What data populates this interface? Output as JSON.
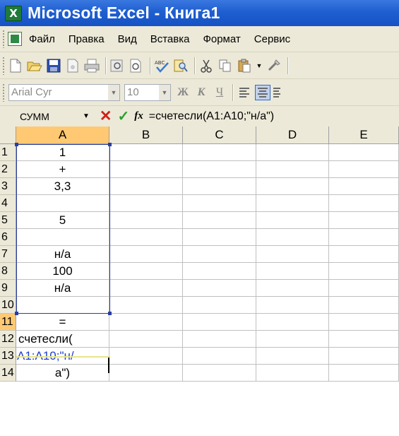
{
  "window": {
    "title": "Microsoft Excel - Книга1",
    "app_icon": "X"
  },
  "menu": {
    "items": [
      {
        "label": "Файл"
      },
      {
        "label": "Правка"
      },
      {
        "label": "Вид"
      },
      {
        "label": "Вставка"
      },
      {
        "label": "Формат"
      },
      {
        "label": "Сервис"
      }
    ]
  },
  "toolbar": {
    "icons": [
      "new-icon",
      "open-icon",
      "save-icon",
      "permission-icon",
      "print-icon",
      "print-preview-icon",
      "spelling-icon",
      "research-icon",
      "cut-icon",
      "copy-icon",
      "paste-icon",
      "format-painter-icon"
    ]
  },
  "format_toolbar": {
    "font_name": "Arial Cyr",
    "font_size": "10",
    "bold_label": "Ж",
    "italic_label": "К",
    "underline_label": "Ч"
  },
  "formula_bar": {
    "name_box": "СУММ",
    "formula": "=счетесли(A1:A10;\"н/а\")"
  },
  "columns": [
    "A",
    "B",
    "C",
    "D",
    "E"
  ],
  "rows": [
    {
      "num": "1",
      "a": "1"
    },
    {
      "num": "2",
      "a": "+"
    },
    {
      "num": "3",
      "a": "3,3"
    },
    {
      "num": "4",
      "a": ""
    },
    {
      "num": "5",
      "a": "5"
    },
    {
      "num": "6",
      "a": ""
    },
    {
      "num": "7",
      "a": "н/а"
    },
    {
      "num": "8",
      "a": "100"
    },
    {
      "num": "9",
      "a": "н/а"
    },
    {
      "num": "10",
      "a": ""
    },
    {
      "num": "11",
      "a": "="
    },
    {
      "num": "12",
      "a": "счетесли("
    },
    {
      "num": "13",
      "a": "A1:A10;\"н/"
    },
    {
      "num": "14",
      "a": "а\")"
    }
  ],
  "colors": {
    "titlebar": "#1e5fd0",
    "chrome": "#ece9d8",
    "selected_header": "#ffc973",
    "range_border": "#2a3ea0",
    "reference_text": "#1e3fd0"
  }
}
